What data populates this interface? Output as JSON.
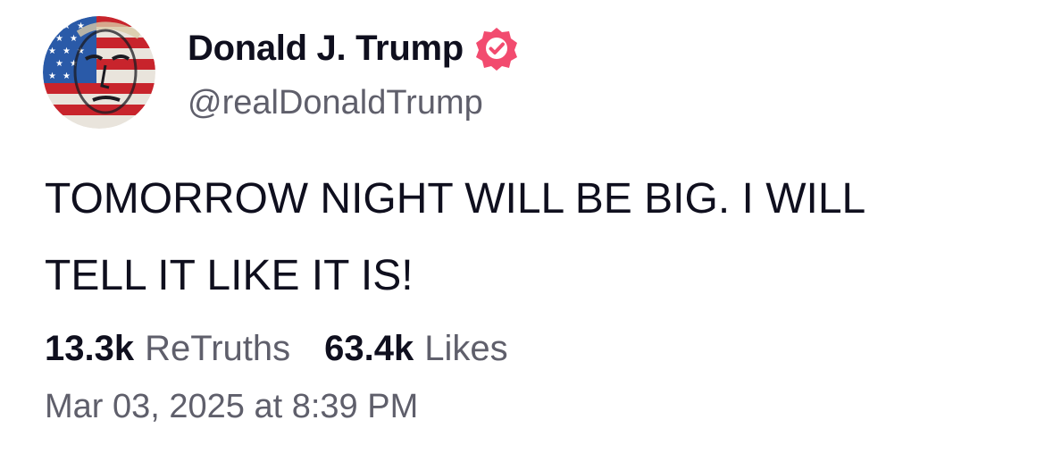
{
  "author": {
    "display_name": "Donald J. Trump",
    "handle": "@realDonaldTrump",
    "verified": true,
    "verified_color": "#f24b6f",
    "avatar_icon": "avatar-image"
  },
  "post": {
    "text": "TOMORROW NIGHT WILL BE BIG. I WILL\nTELL IT LIKE IT IS!",
    "stats": {
      "retruths_count": "13.3k",
      "retruths_label": "ReTruths",
      "likes_count": "63.4k",
      "likes_label": "Likes"
    },
    "timestamp": "Mar 03, 2025 at 8:39 PM"
  },
  "colors": {
    "text_primary": "#0f0f1e",
    "text_secondary": "#5f5f6b",
    "background": "#ffffff"
  }
}
